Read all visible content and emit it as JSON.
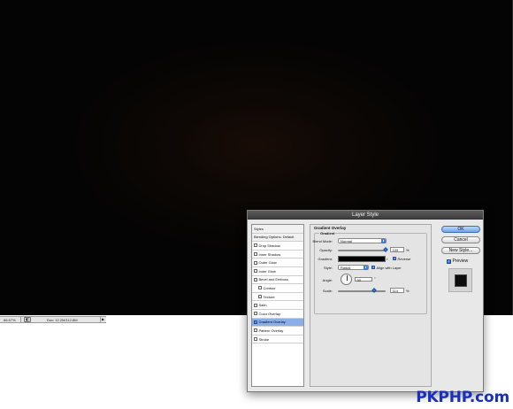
{
  "statusbar": {
    "zoom": "66.67%",
    "doc": "Doc: 12.2M/112.8M"
  },
  "dialog": {
    "title": "Layer Style",
    "styles_list": [
      {
        "label": "Styles",
        "kind": "header"
      },
      {
        "label": "Blending Options: Default",
        "kind": "header"
      },
      {
        "label": "Drop Shadow",
        "checked": false,
        "indent": false,
        "selected": false
      },
      {
        "label": "Inner Shadow",
        "checked": false,
        "indent": false,
        "selected": false
      },
      {
        "label": "Outer Glow",
        "checked": false,
        "indent": false,
        "selected": false
      },
      {
        "label": "Inner Glow",
        "checked": false,
        "indent": false,
        "selected": false
      },
      {
        "label": "Bevel and Emboss",
        "checked": false,
        "indent": false,
        "selected": false
      },
      {
        "label": "Contour",
        "checked": false,
        "indent": true,
        "selected": false
      },
      {
        "label": "Texture",
        "checked": false,
        "indent": true,
        "selected": false
      },
      {
        "label": "Satin",
        "checked": false,
        "indent": false,
        "selected": false
      },
      {
        "label": "Color Overlay",
        "checked": false,
        "indent": false,
        "selected": false
      },
      {
        "label": "Gradient Overlay",
        "checked": true,
        "indent": false,
        "selected": true
      },
      {
        "label": "Pattern Overlay",
        "checked": false,
        "indent": false,
        "selected": false
      },
      {
        "label": "Stroke",
        "checked": false,
        "indent": false,
        "selected": false
      }
    ],
    "section_title": "Gradient Overlay",
    "group_title": "Gradient",
    "blend_mode": {
      "label": "Blend Mode:",
      "value": "Normal"
    },
    "opacity": {
      "label": "Opacity:",
      "value": "100",
      "unit": "%",
      "level": 1.0
    },
    "gradient": {
      "label": "Gradient:",
      "reverse_label": "Reverse",
      "reverse_checked": true
    },
    "style": {
      "label": "Style:",
      "value": "Radial",
      "align_label": "Align with Layer",
      "align_checked": true
    },
    "angle": {
      "label": "Angle:",
      "value": "90",
      "unit": "°"
    },
    "scale": {
      "label": "Scale:",
      "value": "114",
      "unit": "%",
      "level": 0.76
    },
    "buttons": {
      "ok": "OK",
      "cancel": "Cancel",
      "new_style": "New Style..."
    },
    "preview": {
      "label": "Preview",
      "checked": true
    }
  },
  "watermark": "PKPHP.com"
}
